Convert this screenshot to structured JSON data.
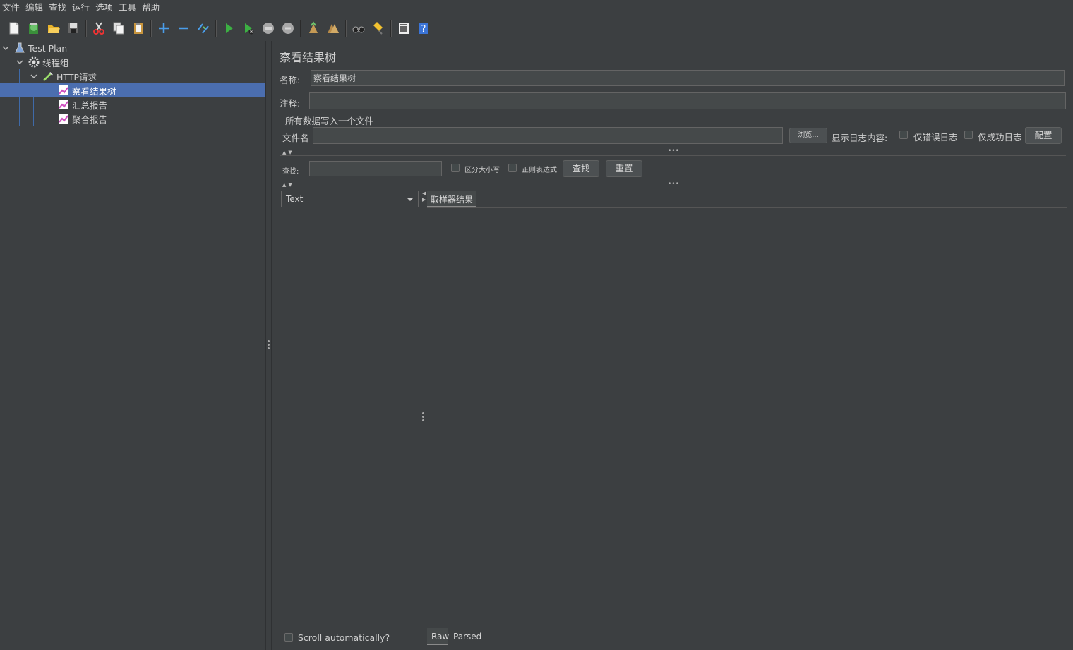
{
  "menu": [
    "文件",
    "编辑",
    "查找",
    "运行",
    "选项",
    "工具",
    "帮助"
  ],
  "toolbar": {
    "icons": [
      "new-icon",
      "templates-icon",
      "open-icon",
      "save-icon",
      "cut-icon",
      "copy-icon",
      "paste-icon",
      "expand-icon",
      "collapse-icon",
      "toggle-icon",
      "start-icon",
      "start-no-pause-icon",
      "stop-icon",
      "shutdown-icon",
      "clear-icon",
      "clear-all-icon",
      "search-icon",
      "reset-search-icon",
      "function-helper-icon",
      "help-icon"
    ]
  },
  "tree": {
    "test_plan": "Test Plan",
    "thread_group": "线程组",
    "http_request": "HTTP请求",
    "view_results_tree": "察看结果树",
    "summary_report": "汇总报告",
    "aggregate_report": "聚合报告"
  },
  "panel": {
    "title": "察看结果树",
    "name_label": "名称:",
    "name_value": "察看结果树",
    "comment_label": "注释:",
    "comment_value": "",
    "file_group_title": "所有数据写入一个文件",
    "filename_label": "文件名",
    "filename_value": "",
    "browse_button": "浏览...",
    "log_contents_label": "显示日志内容:",
    "errors_only": "仅错误日志",
    "success_only": "仅成功日志",
    "configure_button": "配置",
    "search_label": "查找:",
    "search_value": "",
    "case_sensitive": "区分大小写",
    "regex": "正则表达式",
    "find_button": "查找",
    "reset_button": "重置",
    "renderer_selected": "Text",
    "sampler_result_tab": "取样器结果",
    "scroll_auto": "Scroll automatically?",
    "raw_tab": "Raw",
    "parsed_tab": "Parsed"
  }
}
